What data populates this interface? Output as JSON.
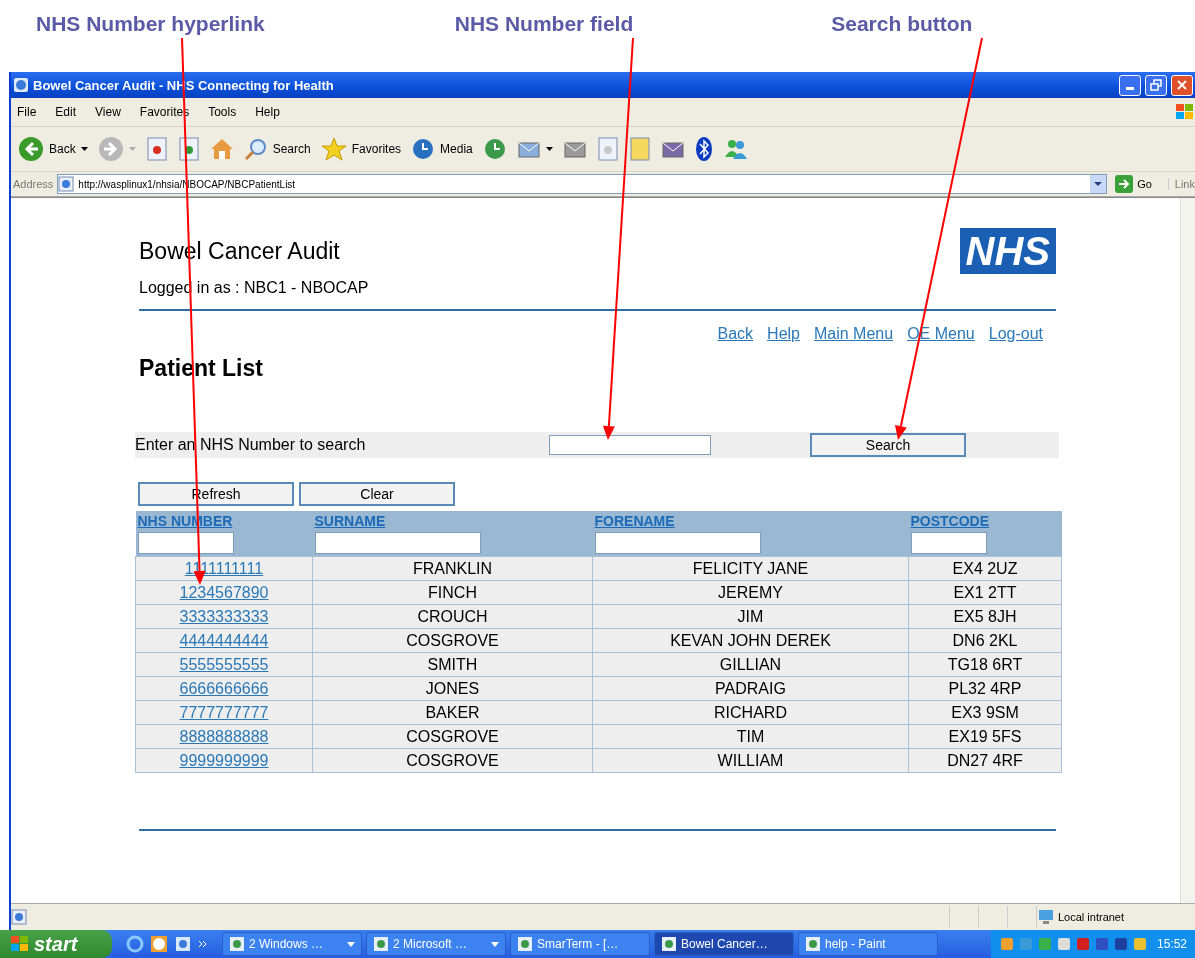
{
  "annotations": [
    {
      "label": "NHS Number hyperlink"
    },
    {
      "label": "NHS Number field"
    },
    {
      "label": "Search button"
    }
  ],
  "window": {
    "title": "Bowel Cancer Audit - NHS Connecting for Health"
  },
  "menu": [
    "File",
    "Edit",
    "View",
    "Favorites",
    "Tools",
    "Help"
  ],
  "toolbar": [
    {
      "kind": "back",
      "label": "Back"
    },
    {
      "kind": "forward"
    },
    {
      "kind": "stop"
    },
    {
      "kind": "refresh"
    },
    {
      "kind": "home"
    },
    {
      "kind": "search",
      "label": "Search"
    },
    {
      "kind": "favorites",
      "label": "Favorites"
    },
    {
      "kind": "media",
      "label": "Media"
    },
    {
      "kind": "history"
    },
    {
      "kind": "mail"
    },
    {
      "kind": "print"
    },
    {
      "kind": "edit"
    },
    {
      "kind": "note"
    },
    {
      "kind": "research"
    },
    {
      "kind": "bluetooth"
    },
    {
      "kind": "messenger"
    }
  ],
  "address": {
    "label": "Address",
    "url": "http://wasplinux1/nhsia/NBOCAP/NBCPatientList",
    "go": "Go",
    "links": "Link"
  },
  "page": {
    "title": "Bowel Cancer Audit",
    "logged_in": "Logged in as : NBC1 - NBOCAP",
    "logo": "NHS",
    "nav": [
      "Back",
      "Help",
      "Main Menu",
      "OE Menu",
      "Log-out"
    ],
    "heading": "Patient List",
    "search": {
      "label": "Enter an NHS Number to search",
      "button": "Search"
    },
    "buttons": [
      "Refresh",
      "Clear"
    ],
    "table": {
      "columns": [
        "NHS NUMBER",
        "SURNAME",
        "FORENAME",
        "POSTCODE"
      ],
      "rows": [
        [
          "1111111111",
          "FRANKLIN",
          "FELICITY JANE",
          "EX4 2UZ"
        ],
        [
          "1234567890",
          "FINCH",
          "JEREMY",
          "EX1 2TT"
        ],
        [
          "3333333333",
          "CROUCH",
          "JIM",
          "EX5 8JH"
        ],
        [
          "4444444444",
          "COSGROVE",
          "KEVAN JOHN DEREK",
          "DN6 2KL"
        ],
        [
          "5555555555",
          "SMITH",
          "GILLIAN",
          "TG18 6RT"
        ],
        [
          "6666666666",
          "JONES",
          "PADRAIG",
          "PL32 4RP"
        ],
        [
          "7777777777",
          "BAKER",
          "RICHARD",
          "EX3 9SM"
        ],
        [
          "8888888888",
          "COSGROVE",
          "TIM",
          "EX19 5FS"
        ],
        [
          "9999999999",
          "COSGROVE",
          "WILLIAM",
          "DN27 4RF"
        ]
      ]
    }
  },
  "status_bar": {
    "zone": "Local intranet"
  },
  "taskbar": {
    "start": "start",
    "tasks": [
      {
        "label": "2 Windows …",
        "selected": false,
        "grouped": true
      },
      {
        "label": "2 Microsoft …",
        "selected": false,
        "grouped": true
      },
      {
        "label": "SmarTerm - […",
        "selected": false,
        "grouped": false
      },
      {
        "label": "Bowel Cancer…",
        "selected": true,
        "grouped": false
      },
      {
        "label": "help - Paint",
        "selected": false,
        "grouped": false
      }
    ],
    "clock": "15:52"
  }
}
